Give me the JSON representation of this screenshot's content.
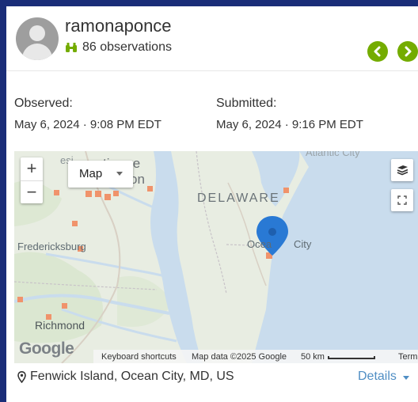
{
  "header": {
    "username": "ramonaponce",
    "observations_text": "86 observations",
    "prev_icon": "chevron-left-icon",
    "next_icon": "chevron-right-icon"
  },
  "dates": {
    "observed_label": "Observed:",
    "observed_value": "May 6, 2024 · 9:08 PM EDT",
    "submitted_label": "Submitted:",
    "submitted_value": "May 6, 2024 · 9:16 PM EDT"
  },
  "map": {
    "zoom_in": "+",
    "zoom_out": "−",
    "map_type": "Map",
    "labels": {
      "atlantic": "Atlantic City",
      "baltimore": "timore",
      "on": "on",
      "es": "esi",
      "delaware": "DELAWARE",
      "fredericksburg": "Fredericksburg",
      "ocean": "Ocea",
      "city": "City",
      "richmond": "Richmond"
    },
    "google": "Google",
    "attribution": {
      "keyboard": "Keyboard shortcuts",
      "map_data": "Map data ©2025 Google",
      "scale": "50 km",
      "terms": "Terms"
    },
    "marker_color": "#2979d4",
    "observation_square_color": "#f0936b"
  },
  "location": {
    "place": "Fenwick Island, Ocean City, MD, US",
    "details_label": "Details"
  },
  "colors": {
    "accent_green": "#74ac00",
    "link_blue": "#4f8ec4",
    "page_border": "#1a2d78"
  }
}
